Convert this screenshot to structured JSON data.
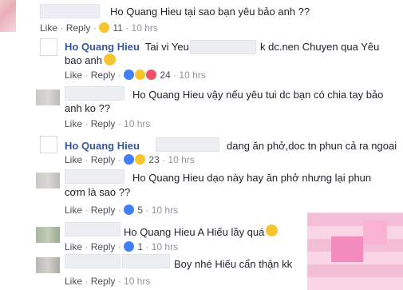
{
  "comments": [
    {
      "author": "Ho Quang Hieu",
      "text_a": "tại sao bạn yêu bảo anh ??",
      "reply_label": "Reply",
      "like_label": "Like",
      "reactions": "11",
      "time": "10 hrs"
    },
    {
      "author": "Ho Quang Hieu",
      "text_a": "Tai vi Yeu",
      "text_b": "k dc.nen Chuyen qua Yêu",
      "text_line2": "bao anh",
      "like_label": "Like",
      "reply_label": "Reply",
      "reactions": "24",
      "time": "10 hrs"
    },
    {
      "author": "Ho Quang Hieu",
      "text_a": "vậy nếu yêu tui dc bạn có chia tay bảo",
      "text_line2": "anh ko ??",
      "like_label": "Like",
      "reply_label": "Reply",
      "time": "10 hrs"
    },
    {
      "author": "Ho Quang Hieu",
      "text_a": "dang ăn phở,doc tn phun cả ra ngoai",
      "like_label": "Like",
      "reply_label": "Reply",
      "reactions": "23",
      "time": "10 hrs"
    },
    {
      "author": "Ho Quang Hieu",
      "text_a": "dạo này hay ăn phở nhưng lại phun",
      "text_line2": "cơm là sao ??",
      "like_label": "Like",
      "reply_label": "Reply",
      "reactions": "5",
      "time": "10 hrs"
    },
    {
      "author": "Ho Quang Hieu",
      "text_a": "A Hiếu lầy quá",
      "like_label": "Like",
      "reply_label": "Reply",
      "reactions": "1",
      "time": "10 hrs"
    },
    {
      "text_a": "Boy nhé Hiếu cẩn thận kk",
      "like_label": "Like",
      "reply_label": "Reply",
      "time": "10 hrs"
    }
  ],
  "icons": [
    "avatar",
    "like-reaction-icon",
    "haha-reaction-icon",
    "love-reaction-icon",
    "sad-reaction-icon",
    "smile-emoji-icon"
  ],
  "colors": {
    "link": "#365899",
    "meta": "#90949c",
    "like": "#4080ff",
    "love": "#f25268",
    "haha": "#f7c52d"
  }
}
